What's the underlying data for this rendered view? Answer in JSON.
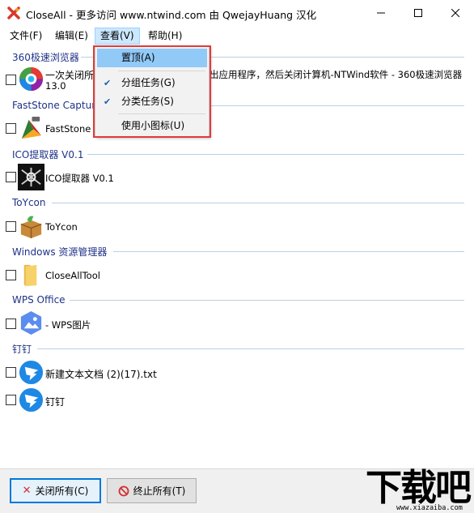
{
  "window": {
    "title": "CloseAll - 更多访问 www.ntwind.com 由 QwejayHuang 汉化"
  },
  "menubar": {
    "file": "文件(F)",
    "edit": "编辑(E)",
    "view": "查看(V)",
    "help": "帮助(H)"
  },
  "view_menu": {
    "items": [
      {
        "label": "置顶(A)",
        "checked": false,
        "highlighted": true
      },
      {
        "label": "分组任务(G)",
        "checked": true,
        "highlighted": false
      },
      {
        "label": "分类任务(S)",
        "checked": true,
        "highlighted": false
      },
      {
        "label": "使用小图标(U)",
        "checked": false,
        "highlighted": false
      }
    ]
  },
  "groups": [
    {
      "header": "360极速浏览器",
      "tasks": [
        {
          "title": "一次关闭所",
          "title_rest": "出应用程序，然后关闭计算机-NTWind软件 - 360极速浏览器",
          "title_line2": "13.0",
          "icon": "360-browser-icon",
          "checked": false
        }
      ]
    },
    {
      "header": "FastStone Captur",
      "tasks": [
        {
          "title": "FastStone C",
          "icon": "faststone-capture-icon",
          "checked": false
        }
      ]
    },
    {
      "header": "ICO提取器 V0.1",
      "tasks": [
        {
          "title": "ICO提取器 V0.1",
          "icon": "ico-extractor-icon",
          "checked": false
        }
      ]
    },
    {
      "header": "ToYcon",
      "tasks": [
        {
          "title": "ToYcon",
          "icon": "toycon-box-icon",
          "checked": false
        }
      ]
    },
    {
      "header": "Windows 资源管理器",
      "tasks": [
        {
          "title": "CloseAllTool",
          "icon": "folder-icon",
          "checked": false
        }
      ]
    },
    {
      "header": "WPS Office",
      "tasks": [
        {
          "title": "- WPS图片",
          "icon": "wps-picture-icon",
          "checked": false
        }
      ]
    },
    {
      "header": "钉钉",
      "tasks": [
        {
          "title": "新建文本文档 (2)(17).txt",
          "icon": "dingtalk-icon",
          "checked": false
        },
        {
          "title": "钉钉",
          "icon": "dingtalk-icon",
          "checked": false
        }
      ]
    }
  ],
  "bottom": {
    "close_all": "关闭所有(C)",
    "kill_all": "终止所有(T)"
  },
  "watermark": {
    "big": "下载吧",
    "small": "www.xiazaiba.com"
  },
  "colors": {
    "accent": "#0078d7",
    "menu_highlight": "#91c9f7",
    "group_header": "#1e3287",
    "annotation_red": "#e23b3b"
  }
}
